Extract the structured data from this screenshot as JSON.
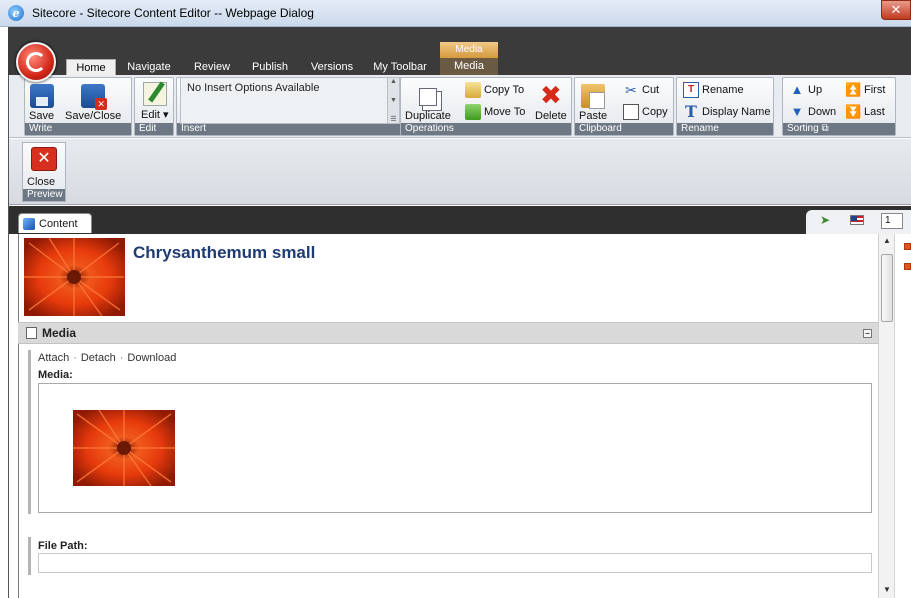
{
  "window": {
    "title": "Sitecore - Sitecore Content Editor -- Webpage Dialog",
    "close_glyph": "✕"
  },
  "ribbon_tabs": [
    {
      "label": "Home"
    },
    {
      "label": "Navigate"
    },
    {
      "label": "Review"
    },
    {
      "label": "Publish"
    },
    {
      "label": "Versions"
    },
    {
      "label": "My Toolbar"
    }
  ],
  "contextual": {
    "group_label": "Media",
    "tab_label": "Media"
  },
  "groups": {
    "write": {
      "label": "Write",
      "save": "Save",
      "save_close": "Save/Close"
    },
    "edit": {
      "label": "Edit",
      "edit": "Edit ▾"
    },
    "insert": {
      "label": "Insert",
      "empty_text": "No Insert Options Available"
    },
    "operations": {
      "label": "Operations",
      "duplicate": "Duplicate",
      "copy_to": "Copy To",
      "move_to": "Move To",
      "delete": "Delete"
    },
    "clipboard": {
      "label": "Clipboard",
      "paste": "Paste",
      "cut": "Cut",
      "copy": "Copy"
    },
    "rename": {
      "label": "Rename",
      "rename": "Rename",
      "display_name": "Display Name"
    },
    "sorting": {
      "label": "Sorting ⧉",
      "up": "Up",
      "down": "Down",
      "first": "First",
      "last": "Last"
    }
  },
  "preview": {
    "label": "Preview",
    "close": "Close"
  },
  "content_tab": {
    "label": "Content",
    "version": "1"
  },
  "item": {
    "title": "Chrysanthemum small"
  },
  "section": {
    "title": "Media",
    "collapse_glyph": "–"
  },
  "media_field": {
    "actions": [
      "Attach",
      "Detach",
      "Download"
    ],
    "separator": "·",
    "label": "Media:"
  },
  "filepath_field": {
    "label": "File Path:",
    "value": ""
  },
  "colors": {
    "title_text": "#1f3b73",
    "ribbon_group_label": "#6e7884",
    "dark_strip": "#3b3b3b",
    "contextual_tab": "#d59a3c"
  }
}
